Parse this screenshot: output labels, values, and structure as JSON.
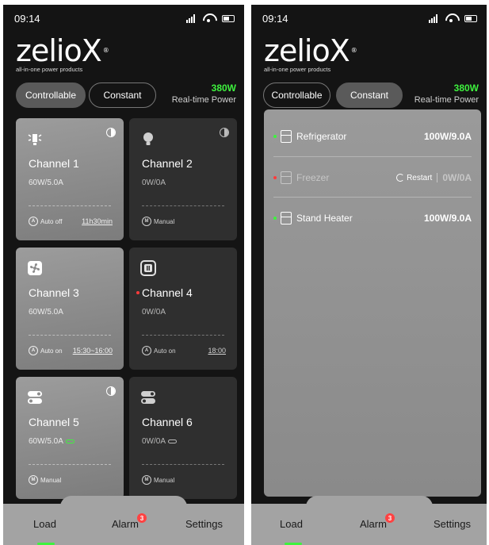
{
  "status": {
    "time": "09:14"
  },
  "brand": {
    "name": "zelioX",
    "tagline": "all-in-one power products",
    "mark": "®"
  },
  "segments": {
    "controllable": "Controllable",
    "constant": "Constant"
  },
  "power": {
    "value": "380W",
    "label": "Real-time Power"
  },
  "channels": [
    {
      "name": "Channel 1",
      "power": "60W/5.0A",
      "mode": "Auto off",
      "mode_code": "A",
      "time": "11h30min",
      "on": true,
      "icon": "light-bulb-on-icon"
    },
    {
      "name": "Channel 2",
      "power": "0W/0A",
      "mode": "Manual",
      "mode_code": "M",
      "time": "",
      "on": false,
      "icon": "light-bulb-icon"
    },
    {
      "name": "Channel 3",
      "power": "60W/5.0A",
      "mode": "Auto on",
      "mode_code": "A",
      "time": "15:30~16:00",
      "on": true,
      "icon": "fan-icon"
    },
    {
      "name": "Channel 4",
      "power": "0W/0A",
      "mode": "Auto on",
      "mode_code": "A",
      "time": "18:00",
      "on": false,
      "icon": "socket-icon",
      "alert": true
    },
    {
      "name": "Channel 5",
      "power": "60W/5.0A",
      "mode": "Manual",
      "mode_code": "M",
      "time": "",
      "on": true,
      "icon": "switch-icon",
      "linked": true
    },
    {
      "name": "Channel 6",
      "power": "0W/0A",
      "mode": "Manual",
      "mode_code": "M",
      "time": "",
      "on": false,
      "icon": "switch-icon",
      "linked": true
    }
  ],
  "constant_loads": [
    {
      "name": "Refrigerator",
      "value": "100W/9.0A",
      "status": "on"
    },
    {
      "name": "Freezer",
      "value": "0W/0A",
      "status": "off",
      "action": "Restart"
    },
    {
      "name": "Stand Heater",
      "value": "100W/9.0A",
      "status": "on"
    }
  ],
  "tabs": {
    "load": "Load",
    "alarm": "Alarm",
    "alarm_badge": "3",
    "settings": "Settings"
  },
  "colors": {
    "accent": "#3ef23e",
    "alert": "#ff3b3b",
    "background": "#141414",
    "card_on": "#8c8c8c",
    "card_off": "#2f2f2f"
  }
}
